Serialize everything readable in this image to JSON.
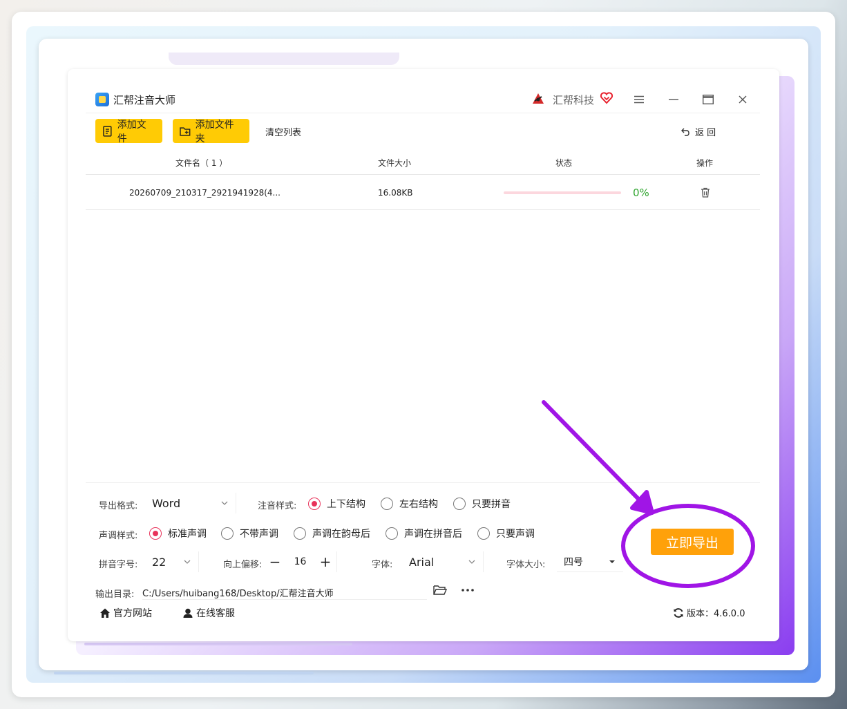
{
  "app": {
    "title": "汇帮注音大师",
    "brand": "汇帮科技"
  },
  "toolbar": {
    "add_file": "添加文件",
    "add_folder": "添加文件夹",
    "clear_list": "清空列表",
    "back": "返 回"
  },
  "table": {
    "headers": [
      "文件名（ 1 ）",
      "文件大小",
      "状态",
      "操作"
    ],
    "rows": [
      {
        "name": "20260709_210317_2921941928(4...",
        "size": "16.08KB",
        "progress": 0,
        "progress_text": "0%"
      }
    ]
  },
  "settings": {
    "export_format_label": "导出格式:",
    "export_format_value": "Word",
    "phonetic_style_label": "注音样式:",
    "phonetic_styles": [
      {
        "label": "上下结构",
        "selected": true
      },
      {
        "label": "左右结构",
        "selected": false
      },
      {
        "label": "只要拼音",
        "selected": false
      }
    ],
    "tone_style_label": "声调样式:",
    "tone_styles": [
      {
        "label": "标准声调",
        "selected": true
      },
      {
        "label": "不带声调",
        "selected": false
      },
      {
        "label": "声调在韵母后",
        "selected": false
      },
      {
        "label": "声调在拼音后",
        "selected": false
      },
      {
        "label": "只要声调",
        "selected": false
      }
    ],
    "pinyin_size_label": "拼音字号:",
    "pinyin_size_value": "22",
    "offset_label": "向上偏移:",
    "offset_value": "16",
    "font_label": "字体:",
    "font_value": "Arial",
    "font_size_label": "字体大小:",
    "font_size_value": "四号",
    "output_dir_label": "输出目录:",
    "output_dir_value": "C:/Users/huibang168/Desktop/汇帮注音大师"
  },
  "export_button": "立即导出",
  "footer": {
    "website": "官方网站",
    "support": "在线客服",
    "version": "版本：4.6.0.0"
  },
  "colors": {
    "accent_yellow": "#ffcb05",
    "export_orange": "#ffa10a",
    "radio_selected": "#e8335a",
    "progress_green": "#2fa52f",
    "annotation_purple": "#a015e6"
  }
}
